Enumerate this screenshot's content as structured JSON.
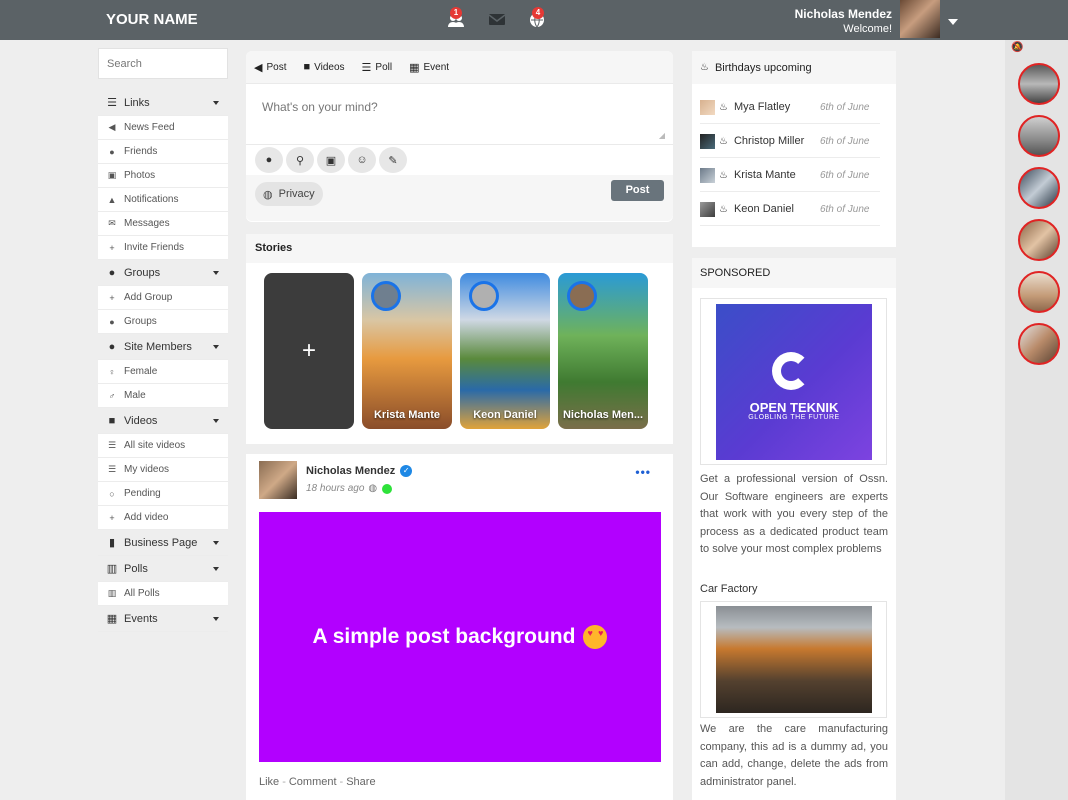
{
  "header": {
    "brand": "YOUR NAME",
    "badges": {
      "friends": "1",
      "notifications": "4"
    },
    "user_name": "Nicholas Mendez",
    "welcome": "Welcome!"
  },
  "sidebar": {
    "search_placeholder": "Search",
    "items": [
      {
        "label": "Links",
        "type": "head",
        "icon": "list-icon"
      },
      {
        "label": "News Feed",
        "icon": "megaphone-icon"
      },
      {
        "label": "Friends",
        "icon": "users-icon"
      },
      {
        "label": "Photos",
        "icon": "image-icon"
      },
      {
        "label": "Notifications",
        "icon": "bell-icon"
      },
      {
        "label": "Messages",
        "icon": "envelope-icon"
      },
      {
        "label": "Invite Friends",
        "icon": "user-plus-icon"
      },
      {
        "label": "Groups",
        "type": "head",
        "icon": "users-icon"
      },
      {
        "label": "Add Group",
        "icon": "plus-icon"
      },
      {
        "label": "Groups",
        "icon": "users-icon"
      },
      {
        "label": "Site Members",
        "type": "head",
        "icon": "users-icon"
      },
      {
        "label": "Female",
        "icon": "female-icon"
      },
      {
        "label": "Male",
        "icon": "male-icon"
      },
      {
        "label": "Videos",
        "type": "head",
        "icon": "video-icon"
      },
      {
        "label": "All site videos",
        "icon": "list-icon"
      },
      {
        "label": "My videos",
        "icon": "list-icon"
      },
      {
        "label": "Pending",
        "icon": "spinner-icon"
      },
      {
        "label": "Add video",
        "icon": "plus-icon"
      },
      {
        "label": "Business Page",
        "type": "head",
        "icon": "building-icon"
      },
      {
        "label": "Polls",
        "type": "head",
        "icon": "chart-icon"
      },
      {
        "label": "All Polls",
        "icon": "chart-icon"
      },
      {
        "label": "Events",
        "type": "head",
        "icon": "calendar-icon"
      }
    ]
  },
  "composer": {
    "tabs": [
      {
        "label": "Post",
        "icon": "bullhorn-icon"
      },
      {
        "label": "Videos",
        "icon": "video-icon"
      },
      {
        "label": "Poll",
        "icon": "list-icon"
      },
      {
        "label": "Event",
        "icon": "calendar-icon"
      }
    ],
    "placeholder": "What's on your mind?",
    "privacy_label": "Privacy",
    "post_label": "Post"
  },
  "stories": {
    "title": "Stories",
    "add_symbol": "+",
    "items": [
      {
        "name": "Krista Mante"
      },
      {
        "name": "Keon Daniel"
      },
      {
        "name": "Nicholas Men..."
      }
    ]
  },
  "post": {
    "author": "Nicholas Mendez",
    "time": "18 hours ago",
    "more": "•••",
    "text": "A simple post background",
    "background_color": "#b200ff",
    "actions": {
      "like": "Like",
      "comment": "Comment",
      "share": "Share"
    }
  },
  "birthdays": {
    "title": "Birthdays upcoming",
    "items": [
      {
        "name": "Mya Flatley",
        "date": "6th of June"
      },
      {
        "name": "Christop Miller",
        "date": "6th of June"
      },
      {
        "name": "Krista Mante",
        "date": "6th of June"
      },
      {
        "name": "Keon Daniel",
        "date": "6th of June"
      }
    ]
  },
  "sponsored": {
    "title": "SPONSORED",
    "ad1": {
      "image_title": "OPEN TEKNIK",
      "image_subtitle": "GLOBLING THE FUTURE",
      "text": "Get a professional version of Ossn. Our Software engineers are experts that work with you every step of the process as a dedicated product team to solve your most complex problems"
    },
    "ad2": {
      "title": "Car Factory",
      "text": "We are the care manufacturing company, this ad is a dummy ad, you can add, change, delete the ads from administrator panel."
    }
  }
}
